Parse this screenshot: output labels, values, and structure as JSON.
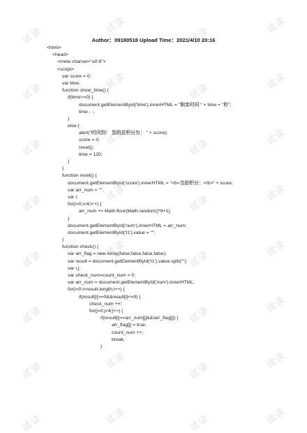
{
  "document": {
    "header": "Author：09180518 Upload Time：2021/4/10 20:16",
    "watermark_text": "试读"
  },
  "code_lines": [
    {
      "indent": 0,
      "text": "<html>"
    },
    {
      "indent": 1,
      "text": "<head>"
    },
    {
      "indent": 2,
      "text": "<meta charset=\"utf-8\">"
    },
    {
      "indent": 2,
      "text": "<script>"
    },
    {
      "indent": 3,
      "text": "var score = 0;"
    },
    {
      "indent": 3,
      "text": "var time;"
    },
    {
      "indent": 3,
      "text": "function show_time() {"
    },
    {
      "indent": 4,
      "text": "if(time>=0) {"
    },
    {
      "indent": 5,
      "text": "document.getElementById('time').innerHTML = \"剩余时间:\" + time + \"秒\";"
    },
    {
      "indent": 5,
      "text": "time - -;"
    },
    {
      "indent": 4,
      "text": "}"
    },
    {
      "indent": 4,
      "text": "else {"
    },
    {
      "indent": 5,
      "text": "alert(\"时间到！ 您的总积分为： \" + score);"
    },
    {
      "indent": 5,
      "text": "score = 0;"
    },
    {
      "indent": 5,
      "text": "reset();"
    },
    {
      "indent": 5,
      "text": "time = 120;"
    },
    {
      "indent": 4,
      "text": "}"
    },
    {
      "indent": 3,
      "text": "}"
    },
    {
      "indent": 3,
      "text": "function reset() {"
    },
    {
      "indent": 4,
      "text": "document.getElementById('score').innerHTML = \"<b>当前积分：</b>\" + score;"
    },
    {
      "indent": 4,
      "text": "var arr_num = \"\";"
    },
    {
      "indent": 4,
      "text": "var i;"
    },
    {
      "indent": 4,
      "text": "for(i=0;i<4;i++) {"
    },
    {
      "indent": 5,
      "text": "arr_num += Math.floor(Math.random()*9+1);"
    },
    {
      "indent": 4,
      "text": "}"
    },
    {
      "indent": 4,
      "text": "document.getElementById('num').innerHTML = arr_num;"
    },
    {
      "indent": 4,
      "text": "document.getElementById('t1').value = \"\";"
    },
    {
      "indent": 3,
      "text": "}"
    },
    {
      "indent": 3,
      "text": "function check() {"
    },
    {
      "indent": 4,
      "text": "var arr_flag = new Array(false,false,false,false);"
    },
    {
      "indent": 4,
      "text": "var result = document.getElementById('t1').value.split(\"\");"
    },
    {
      "indent": 4,
      "text": "var i,j;"
    },
    {
      "indent": 4,
      "text": "var check_num=count_num = 0;"
    },
    {
      "indent": 4,
      "text": "var arr_num = document.getElementById('num').innerHTML;"
    },
    {
      "indent": 4,
      "text": "for(i=0;i<result.length;i++) {"
    },
    {
      "indent": 5,
      "text": "if(result[i]>=0&&result[i]<=9) {"
    },
    {
      "indent": 6,
      "text": "check_num ++;"
    },
    {
      "indent": 6,
      "text": "for(j=0;j<4;j++) {"
    },
    {
      "indent": 7,
      "text": "if(result[i]==arr_num[j]&&!arr_flag[j]) {"
    },
    {
      "indent": 8,
      "text": "arr_flag[j] = true;"
    },
    {
      "indent": 8,
      "text": "count_num ++;"
    },
    {
      "indent": 8,
      "text": "break;"
    },
    {
      "indent": 7,
      "text": "}"
    }
  ]
}
